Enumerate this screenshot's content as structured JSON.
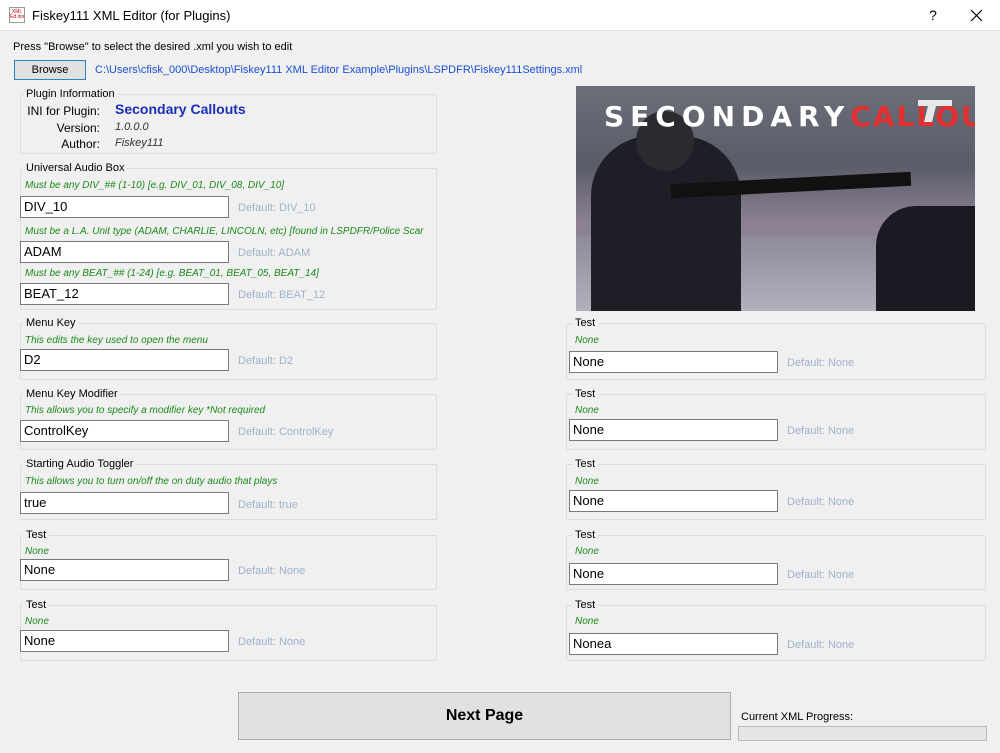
{
  "window": {
    "title": "Fiskey111 XML Editor (for Plugins)",
    "icon_text": "XML Ed.itor",
    "help": "?"
  },
  "header": {
    "instruction": "Press \"Browse\" to select the desired .xml you wish to edit",
    "browse_label": "Browse",
    "file_path": "C:\\Users\\cfisk_000\\Desktop\\Fiskey111 XML Editor Example\\Plugins\\LSPDFR\\Fiskey111Settings.xml"
  },
  "plugin_info": {
    "group_label": "Plugin Information",
    "ini_key": "INI for Plugin:",
    "ini_value": "Secondary Callouts",
    "version_key": "Version:",
    "version_value": "1.0.0.0",
    "author_key": "Author:",
    "author_value": "Fiskey111"
  },
  "banner": {
    "title_part1": "SECONDARY",
    "title_part2": "CALLOUTS"
  },
  "audio_box": {
    "group_label": "Universal Audio Box",
    "fields": [
      {
        "desc": "Must be any DIV_## (1-10) [e.g. DIV_01, DIV_08, DIV_10]",
        "value": "DIV_10",
        "default": "Default: DIV_10"
      },
      {
        "desc": "Must be a L.A. Unit type (ADAM, CHARLIE, LINCOLN, etc) [found in LSPDFR/Police Scar",
        "value": "ADAM",
        "default": "Default: ADAM"
      },
      {
        "desc": "Must be any BEAT_## (1-24) [e.g. BEAT_01, BEAT_05, BEAT_14]",
        "value": "BEAT_12",
        "default": "Default: BEAT_12"
      }
    ]
  },
  "left_groups": [
    {
      "label": "Menu Key",
      "desc": "This edits the key used to open the menu",
      "value": "D2",
      "default": "Default: D2"
    },
    {
      "label": "Menu Key Modifier",
      "desc": "This allows you to specify a modifier key *Not required",
      "value": "ControlKey",
      "default": "Default: ControlKey"
    },
    {
      "label": "Starting Audio Toggler",
      "desc": "This allows you to turn on/off the on duty audio that plays",
      "value": "true",
      "default": "Default: true"
    },
    {
      "label": "Test",
      "desc": "None",
      "value": "None",
      "default": "Default: None"
    },
    {
      "label": "Test",
      "desc": "None",
      "value": "None",
      "default": "Default: None"
    }
  ],
  "right_groups": [
    {
      "label": "Test",
      "desc": "None",
      "value": "None",
      "default": "Default: None"
    },
    {
      "label": "Test",
      "desc": "None",
      "value": "None",
      "default": "Default: None"
    },
    {
      "label": "Test",
      "desc": "None",
      "value": "None",
      "default": "Default: None"
    },
    {
      "label": "Test",
      "desc": "None",
      "value": "None",
      "default": "Default: None"
    },
    {
      "label": "Test",
      "desc": "None",
      "value": "Nonea",
      "default": "Default: None"
    }
  ],
  "footer": {
    "next_label": "Next Page",
    "progress_label": "Current XML Progress:",
    "progress_fraction": 0
  }
}
